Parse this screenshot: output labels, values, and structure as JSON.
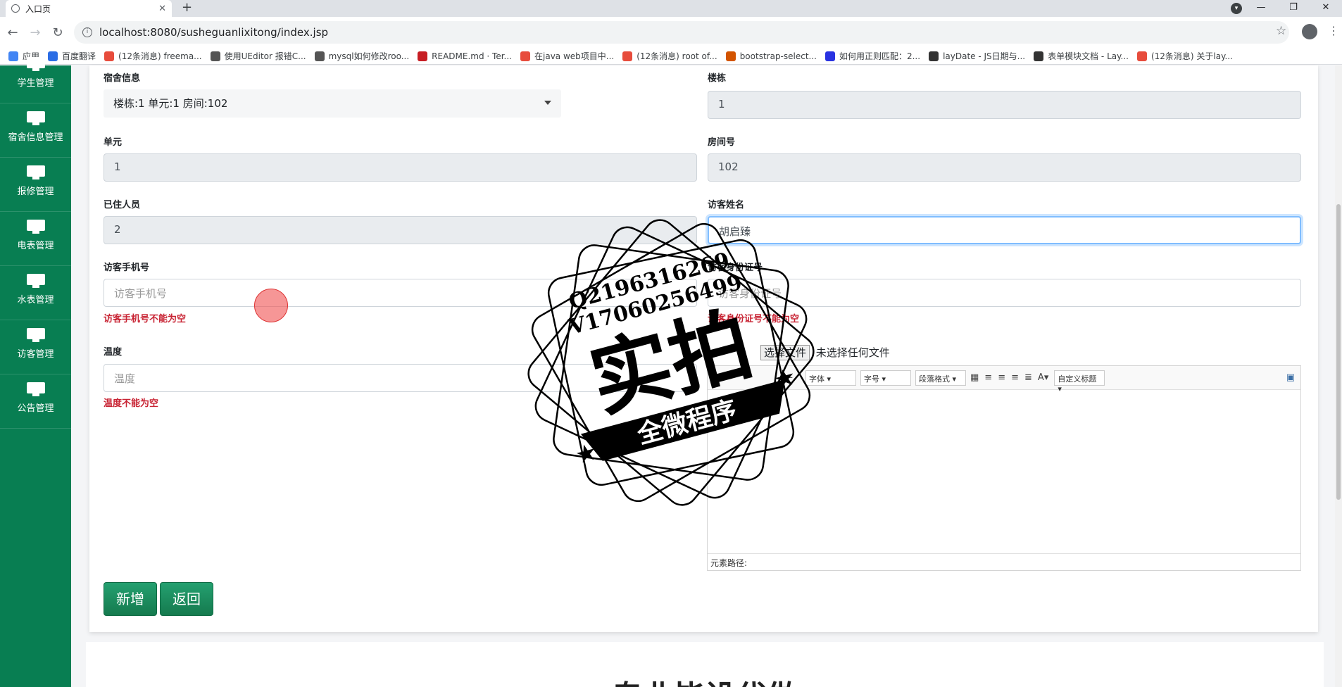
{
  "browser": {
    "tab_title": "入口页",
    "new_tab": "+",
    "url": "localhost:8080/susheguanlixitong/index.jsp",
    "window_controls": [
      "—",
      "❐",
      "✕"
    ],
    "bookmarks": [
      {
        "label": "应用",
        "color": "#4285f4"
      },
      {
        "label": "百度翻译",
        "color": "#2b6de5"
      },
      {
        "label": "(12条消息) freema...",
        "color": "#e74c3c"
      },
      {
        "label": "使用UEditor 报错C...",
        "color": "#555555"
      },
      {
        "label": "mysql如何修改roo...",
        "color": "#555555"
      },
      {
        "label": "README.md · Ter...",
        "color": "#c71d23"
      },
      {
        "label": "在java web项目中...",
        "color": "#e74c3c"
      },
      {
        "label": "(12条消息) root of...",
        "color": "#e74c3c"
      },
      {
        "label": "bootstrap-select...",
        "color": "#d35400"
      },
      {
        "label": "如何用正则匹配：2...",
        "color": "#2932e1"
      },
      {
        "label": "layDate - JS日期与...",
        "color": "#333333"
      },
      {
        "label": "表单模块文档 - Lay...",
        "color": "#333333"
      },
      {
        "label": "(12条消息) 关于lay...",
        "color": "#e74c3c"
      }
    ]
  },
  "sidebar": {
    "items": [
      {
        "label": "学生管理"
      },
      {
        "label": "宿舍信息管理"
      },
      {
        "label": "报修管理"
      },
      {
        "label": "电表管理"
      },
      {
        "label": "水表管理"
      },
      {
        "label": "访客管理"
      },
      {
        "label": "公告管理"
      }
    ]
  },
  "form": {
    "dorm_label": "宿舍信息",
    "dorm_value": "楼栋:1 单元:1 房间:102",
    "building_label": "楼栋",
    "building_value": "1",
    "unit_label": "单元",
    "unit_value": "1",
    "room_label": "房间号",
    "room_value": "102",
    "occupants_label": "已住人员",
    "occupants_value": "2",
    "visitor_name_label": "访客姓名",
    "visitor_name_value": "胡启臻",
    "phone_label": "访客手机号",
    "phone_placeholder": "访客手机号",
    "phone_error": "访客手机号不能为空",
    "idcard_label": "访客身份证号",
    "idcard_placeholder": "访客身份证号",
    "idcard_error": "访客身份证号不能为空",
    "temp_label": "温度",
    "temp_placeholder": "温度",
    "temp_error": "温度不能为空",
    "file_button": "选择文件",
    "file_status": "未选择任何文件",
    "editor": {
      "font_select": "字体",
      "size_select": "字号",
      "paragraph_select": "段落格式",
      "custom_title_select": "自定义标题",
      "status_path": "元素路径:"
    },
    "add_button": "新增",
    "back_button": "返回"
  },
  "bottom": {
    "heading": "专业毕设代做"
  },
  "watermark": {
    "line1": "Q2196316269",
    "line2": "V17060256499",
    "big_text": "实拍",
    "banner": "全微程序"
  }
}
